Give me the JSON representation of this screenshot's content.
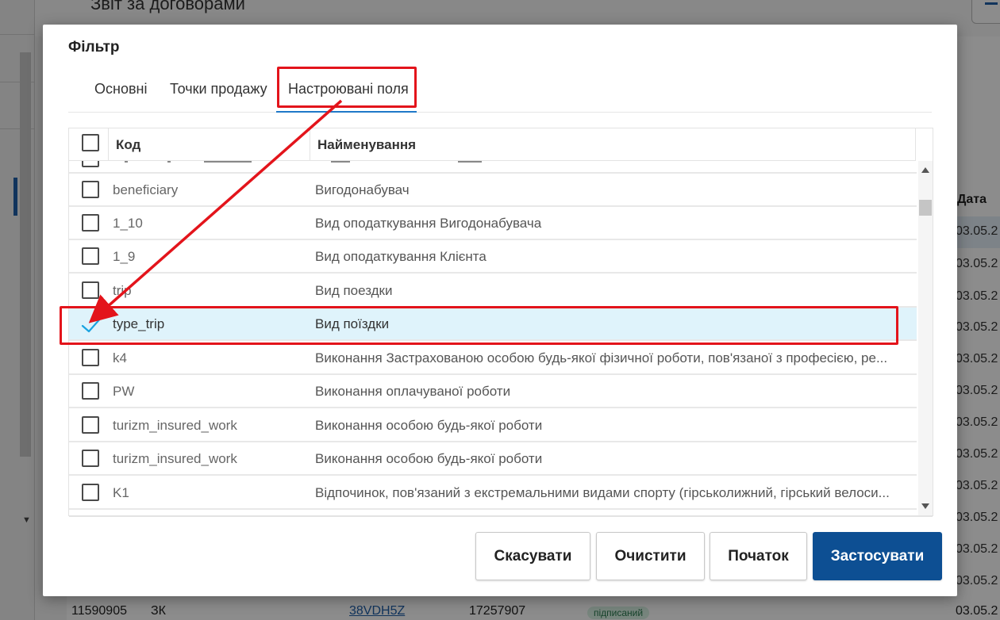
{
  "background": {
    "page_title": "Звіт за договорами",
    "column_date": "Дата",
    "dates": [
      "03.05.2",
      "03.05.2",
      "03.05.2",
      "03.05.2",
      "03.05.2",
      "03.05.2",
      "03.05.2",
      "03.05.2",
      "03.05.2",
      "03.05.2",
      "03.05.2",
      "03.05.2",
      "03.05.2",
      "03.05.2"
    ],
    "bottom_row": {
      "id": "11590905",
      "type": "ЗК",
      "link": "38VDH5Z",
      "number": "17257907",
      "status": "підписаний",
      "date": "03.05.2"
    }
  },
  "modal": {
    "title": "Фільтр",
    "tabs": [
      {
        "label": "Основні",
        "active": false
      },
      {
        "label": "Точки продажу",
        "active": false
      },
      {
        "label": "Настроювані поля",
        "active": true
      }
    ],
    "columns": {
      "code": "Код",
      "name": "Найменування"
    },
    "rows": [
      {
        "code": "beneficiary",
        "name": "Вигодонабувач",
        "checked": false
      },
      {
        "code": "1_10",
        "name": "Вид оподаткування Вигодонабувача",
        "checked": false
      },
      {
        "code": "1_9",
        "name": "Вид оподаткування Клієнта",
        "checked": false
      },
      {
        "code": "trip",
        "name": "Вид поездки",
        "checked": false
      },
      {
        "code": "type_trip",
        "name": "Вид поїздки",
        "checked": true
      },
      {
        "code": "k4",
        "name": "Виконання Застрахованою особою будь-якої фізичної роботи, пов'язаної з професією, ре...",
        "checked": false
      },
      {
        "code": "PW",
        "name": "Виконання оплачуваної роботи",
        "checked": false
      },
      {
        "code": "turizm_insured_work",
        "name": "Виконання особою будь-якої роботи",
        "checked": false
      },
      {
        "code": "turizm_insured_work",
        "name": "Виконання особою будь-якої роботи",
        "checked": false
      },
      {
        "code": "K1",
        "name": "Відпочинок, пов'язаний з екстремальними видами спорту (гірськолижний, гірський велоси...",
        "checked": false
      }
    ],
    "buttons": {
      "cancel": "Скасувати",
      "clear": "Очистити",
      "reset": "Початок",
      "apply": "Застосувати"
    }
  },
  "colors": {
    "accent": "#1f78c8",
    "primary_button": "#0d4f93",
    "selected_row": "#dff3fb",
    "annotation": "#e3141b",
    "checkmark": "#1aa3e0"
  }
}
